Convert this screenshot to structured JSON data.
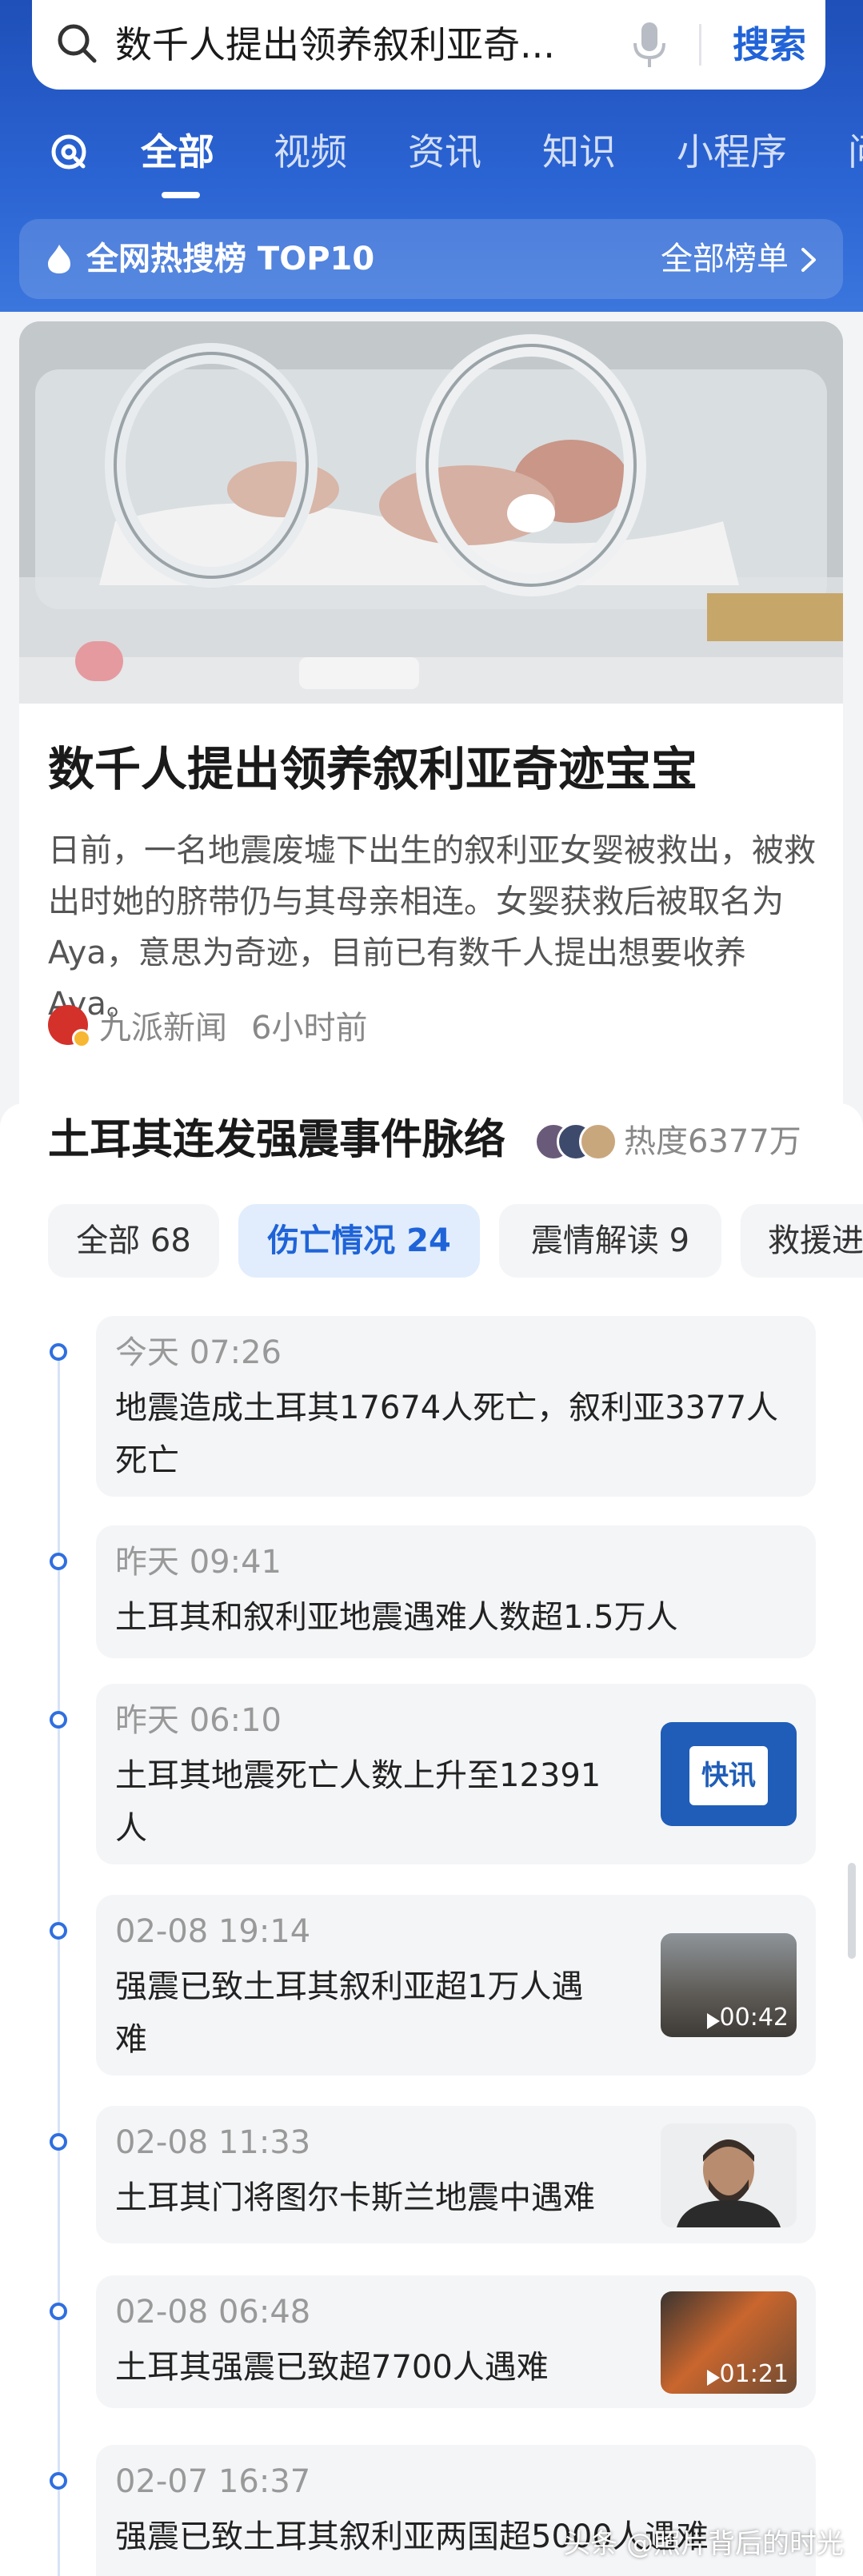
{
  "search": {
    "query": "数千人提出领养叙利亚奇...",
    "button_label": "搜索"
  },
  "tabs": [
    "全部",
    "视频",
    "资讯",
    "知识",
    "小程序",
    "问"
  ],
  "hot_banner": {
    "title": "全网热搜榜 TOP10",
    "link": "全部榜单"
  },
  "news": {
    "title": "数千人提出领养叙利亚奇迹宝宝",
    "summary": "日前，一名地震废墟下出生的叙利亚女婴被救出，被救出时她的脐带仍与其母亲相连。女婴获救后被取名为Aya，意思为奇迹，目前已有数千人提出想要收养Aya。",
    "source": "九派新闻",
    "time": "6小时前"
  },
  "event": {
    "title": "土耳其连发强震事件脉络",
    "heat": "热度6377万",
    "filters": [
      {
        "label": "全部 68"
      },
      {
        "label": "伤亡情况 24"
      },
      {
        "label": "震情解读 9"
      },
      {
        "label": "救援进"
      }
    ],
    "items": [
      {
        "time": "今天 07:26",
        "line1": "地震造成土耳其17674人死亡，叙利亚3377人",
        "line2": "死亡"
      },
      {
        "time": "昨天 09:41",
        "line1": "土耳其和叙利亚地震遇难人数超1.5万人",
        "line2": ""
      },
      {
        "time": "昨天 06:10",
        "line1": "土耳其地震死亡人数上升至12391",
        "line2": "人",
        "thumb_label": "快讯"
      },
      {
        "time": "02-08 19:14",
        "line1": "强震已致土耳其叙利亚超1万人遇",
        "line2": "难",
        "duration": "00:42"
      },
      {
        "time": "02-08 11:33",
        "line1": "土耳其门将图尔卡斯兰地震中遇难",
        "line2": ""
      },
      {
        "time": "02-08 06:48",
        "line1": "土耳其强震已致超7700人遇难",
        "line2": "",
        "duration": "01:21"
      },
      {
        "time": "02-07 16:37",
        "line1": "强震已致土耳其叙利亚两国超5000人遇难",
        "line2": ""
      }
    ]
  },
  "watermark": "头条 @照片背后的时光",
  "colors": {
    "header_blue": "#2a63d2",
    "accent_blue": "#1f63d8",
    "timeline_dot": "#2f6fe0"
  }
}
